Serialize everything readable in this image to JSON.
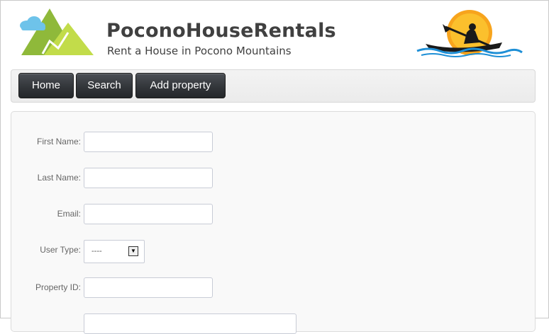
{
  "brand": {
    "title": "PoconoHouseRentals",
    "tagline": "Rent a House in Pocono Mountains"
  },
  "nav": {
    "items": [
      {
        "label": "Home"
      },
      {
        "label": "Search"
      },
      {
        "label": "Add property"
      }
    ]
  },
  "form": {
    "first_name": {
      "label": "First Name:",
      "value": ""
    },
    "last_name": {
      "label": "Last Name:",
      "value": ""
    },
    "email": {
      "label": "Email:",
      "value": ""
    },
    "user_type": {
      "label": "User Type:",
      "selected": "----"
    },
    "property_id": {
      "label": "Property ID:",
      "value": ""
    }
  },
  "icons": {
    "mountain_logo": "mountain-logo-icon",
    "kayak_logo": "kayak-sun-icon",
    "dropdown": "chevron-down-icon"
  },
  "colors": {
    "mountain_green_dark": "#8fb93a",
    "mountain_green_light": "#c2dc4a",
    "cloud_blue": "#6ec3ea",
    "sun_orange": "#f7a41d",
    "water_blue": "#1e8fd6",
    "nav_button": "#33363a",
    "brand_text": "#404040"
  }
}
